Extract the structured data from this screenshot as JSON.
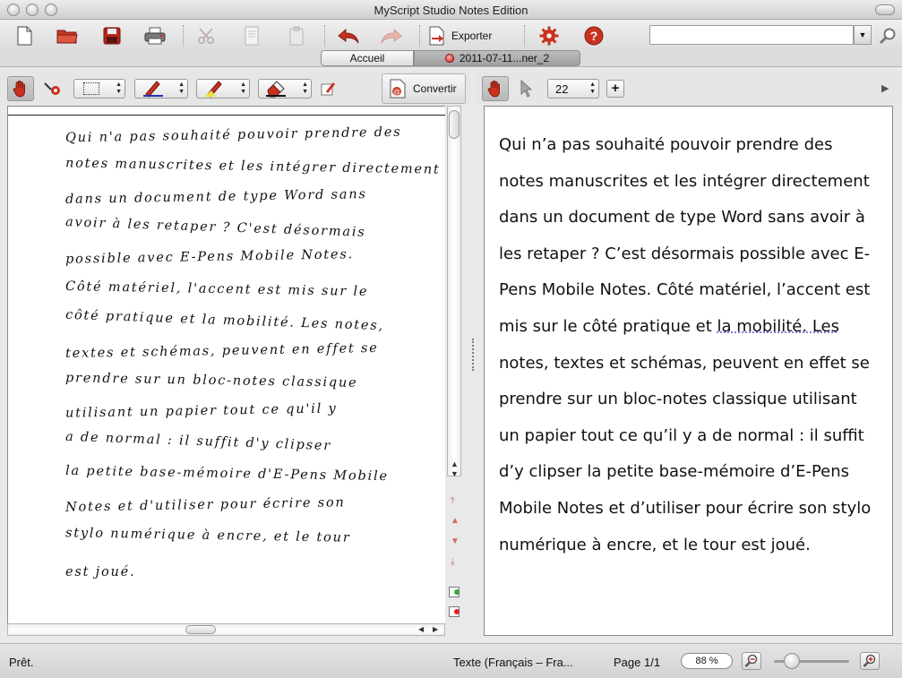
{
  "window": {
    "title": "MyScript Studio Notes Edition"
  },
  "toolbar": {
    "export_label": "Exporter",
    "search_value": "",
    "icons": [
      "new-document-icon",
      "open-folder-icon",
      "save-icon",
      "print-icon",
      "cut-icon",
      "copy-icon",
      "paste-icon",
      "undo-icon",
      "redo-icon",
      "export-icon",
      "settings-icon",
      "help-icon",
      "search-icon"
    ]
  },
  "tabs": [
    {
      "label": "Accueil",
      "active": false
    },
    {
      "label": "2011-07-11...ner_2",
      "active": true
    }
  ],
  "ink_toolbar": {
    "convert_label": "Convertir",
    "pen_color": "#2233aa",
    "highlighter_color": "#f3e23c",
    "eraser_color": "#111111"
  },
  "text_toolbar": {
    "font_size": "22"
  },
  "handwriting": {
    "lines": [
      "Qui n'a pas souhaité pouvoir prendre des",
      "notes manuscrites et les intégrer directement",
      "dans un document de type Word sans",
      "avoir à les retaper ? C'est désormais",
      "possible avec E-Pens Mobile Notes.",
      "Côté matériel, l'accent est mis sur le",
      "côté pratique et la mobilité. Les notes,",
      "textes et schémas, peuvent en effet se",
      "prendre sur un bloc-notes classique",
      "utilisant un papier tout ce qu'il y",
      "a de normal : il suffit d'y clipser",
      "la petite base-mémoire d'E-Pens Mobile",
      "Notes et d'utiliser pour écrire son",
      "stylo numérique à encre, et le tour",
      "est joué."
    ]
  },
  "converted_text": {
    "lines": [
      "Qui n’a pas souhaité pouvoir prendre des",
      "notes manuscrites et les intégrer directement",
      "dans un document de type Word sans avoir à",
      "les retaper ? C’est désormais possible avec E-",
      "Pens Mobile Notes. Côté matériel, l’accent est",
      "mis sur le côté pratique et ",
      "notes, textes et schémas, peuvent en effet se",
      "prendre sur un bloc-notes classique utilisant",
      "un papier tout ce qu’il y a de normal : il suffit",
      "d’y clipser la petite base-mémoire d’E-Pens",
      "Mobile Notes et d’utiliser pour écrire son stylo",
      "numérique à encre, et le tour est joué."
    ],
    "underlined": "la mobilité. Les"
  },
  "status": {
    "message": "Prêt.",
    "language": "Texte (Français – Fra...",
    "page": "Page 1/1",
    "zoom": "88 %",
    "zoom_slider_value": 0.2
  }
}
